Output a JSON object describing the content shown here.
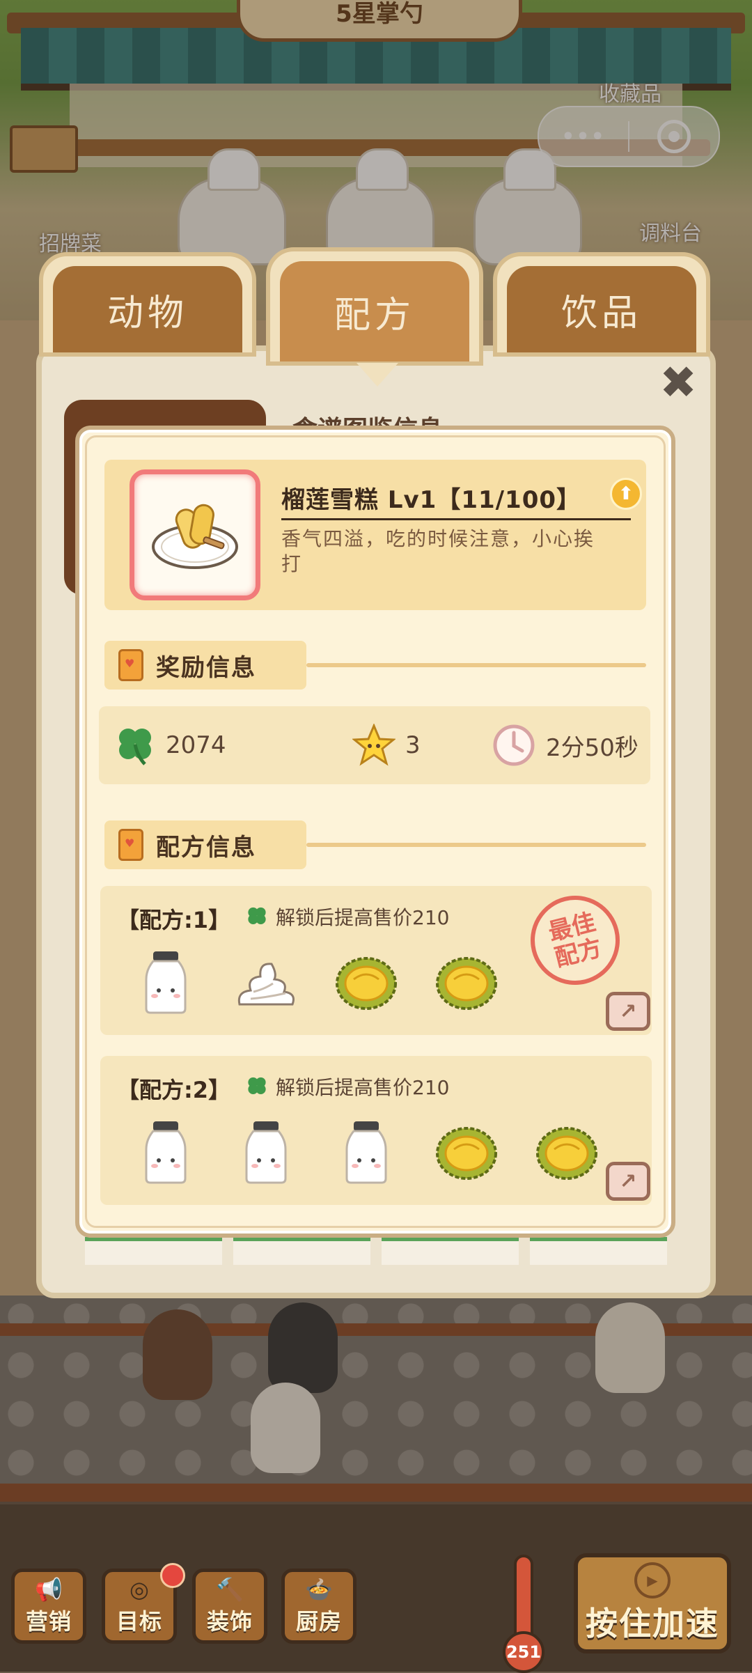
{
  "scene": {
    "star_sign": "5星掌勺",
    "collectibles_label": "收藏品",
    "signature_label": "招牌菜",
    "seasoning_label": "调料台"
  },
  "capsule": {
    "more": "•••",
    "close_icon": "target-icon"
  },
  "tabs": [
    {
      "label": "动物",
      "active": false
    },
    {
      "label": "配方",
      "active": true
    },
    {
      "label": "饮品",
      "active": false
    }
  ],
  "back_panel": {
    "title": "食谱图鉴信息",
    "close_icon": "close-icon"
  },
  "item": {
    "title": "榴莲雪糕 Lv1【11/100】",
    "description": "香气四溢，吃的时候注意，小心挨打",
    "upgrade_icon": "arrow-up-icon"
  },
  "rewards": {
    "heading": "奖励信息",
    "clover_value": "2074",
    "star_value": "3",
    "time_value": "2分50秒"
  },
  "recipes": {
    "heading": "配方信息",
    "best_stamp_line1": "最佳",
    "best_stamp_line2": "配方",
    "list": [
      {
        "label": "【配方:1】",
        "bonus": "解锁后提高售价210",
        "ingredients": [
          "milk",
          "cream",
          "durian",
          "durian"
        ]
      },
      {
        "label": "【配方:2】",
        "bonus": "解锁后提高售价210",
        "ingredients": [
          "milk",
          "milk",
          "milk",
          "durian",
          "durian"
        ]
      }
    ]
  },
  "bottom": {
    "marketing": "营销",
    "goals": "目标",
    "decor": "装饰",
    "kitchen": "厨房",
    "thermo_value": "251",
    "speed": "按住加速"
  },
  "colors": {
    "accent": "#c88d4d",
    "panel": "#fdf3d9",
    "stamp": "#e56a5b",
    "clover": "#3f9a4a"
  }
}
